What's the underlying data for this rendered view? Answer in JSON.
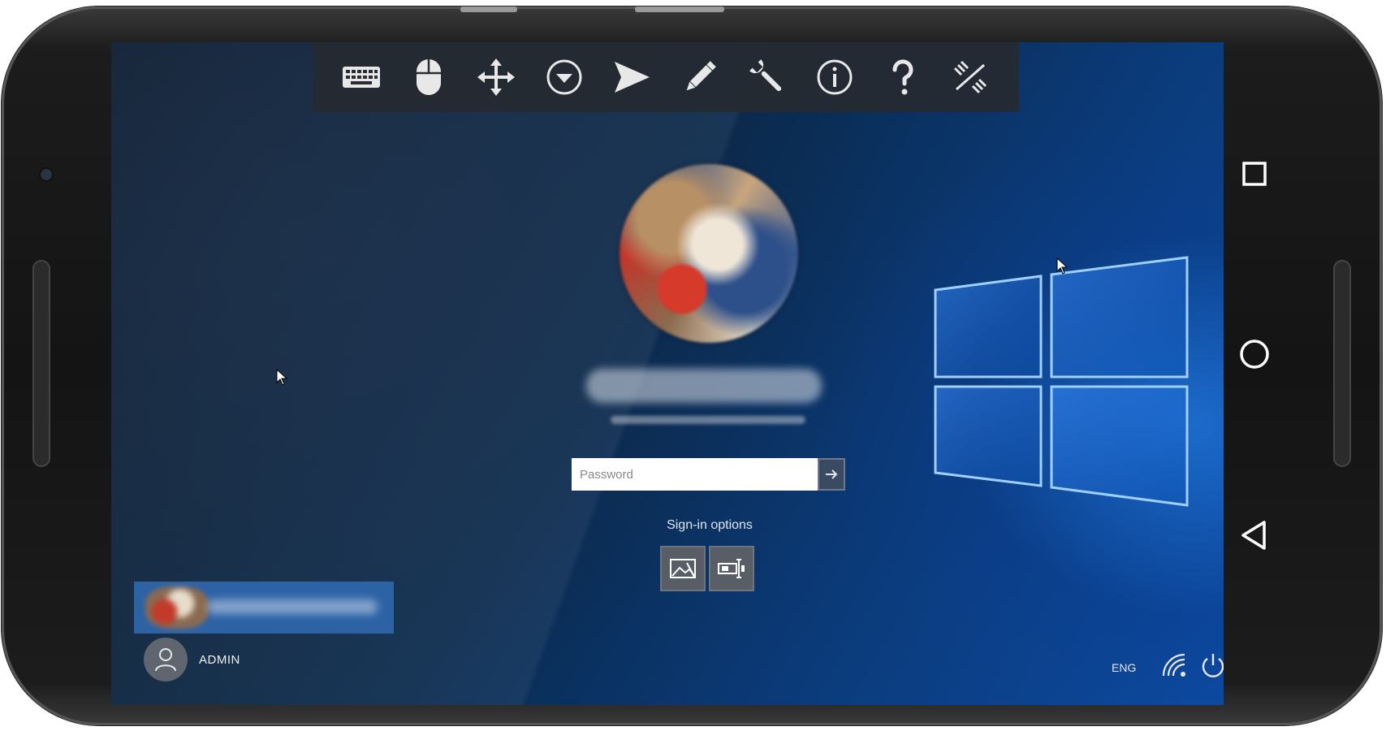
{
  "toolbar": {
    "items": [
      {
        "icon": "keyboard-icon"
      },
      {
        "icon": "mouse-icon"
      },
      {
        "icon": "move-arrows-icon"
      },
      {
        "icon": "dropdown-circle-icon"
      },
      {
        "icon": "send-icon"
      },
      {
        "icon": "pencil-icon"
      },
      {
        "icon": "wrench-icon"
      },
      {
        "icon": "info-icon"
      },
      {
        "icon": "help-icon"
      },
      {
        "icon": "disconnect-icon"
      }
    ]
  },
  "login": {
    "password_placeholder": "Password",
    "signin_options_label": "Sign-in options",
    "options": [
      {
        "icon": "picture-password-icon"
      },
      {
        "icon": "security-key-icon"
      }
    ]
  },
  "users": {
    "other_user_name": "ADMIN"
  },
  "taskbar": {
    "language": "ENG"
  },
  "android_nav": [
    "recent-apps-icon",
    "home-icon",
    "back-icon"
  ],
  "colors": {
    "accent_blue": "#2d63a5",
    "toolbar_bg": "#262a30",
    "desktop_dark": "#071526",
    "desktop_light": "#0c4aa0"
  }
}
